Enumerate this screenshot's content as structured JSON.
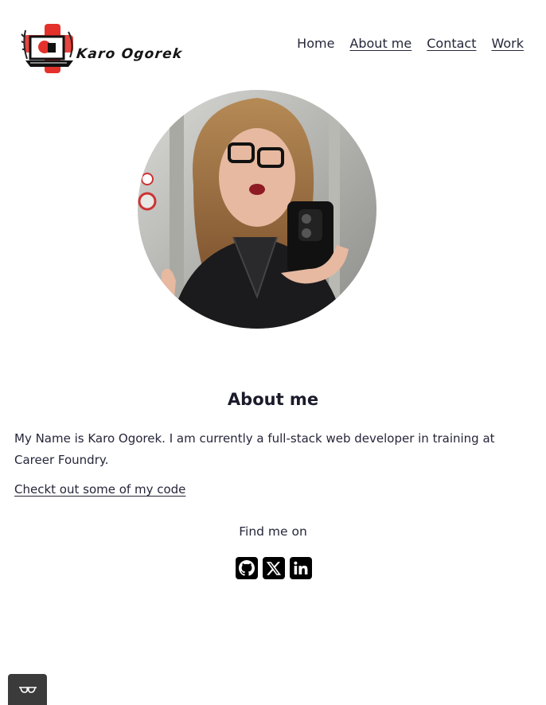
{
  "brand": {
    "name": "Karo Ogorek",
    "logo_icon": "laptop-logo-icon",
    "accent": "#e4312b"
  },
  "nav": {
    "items": [
      {
        "label": "Home",
        "underline": false
      },
      {
        "label": "About me",
        "underline": true
      },
      {
        "label": "Contact",
        "underline": true
      },
      {
        "label": "Work",
        "underline": true
      }
    ]
  },
  "profile": {
    "photo_icon": "profile-photo"
  },
  "about": {
    "title": "About me",
    "text": "My Name is Karo Ogorek. I am currently a full-stack web developer in training at Career Foundry.",
    "code_link": "Checkt out some of my code"
  },
  "social": {
    "heading": "Find me on",
    "icons": [
      "github-icon",
      "x-icon",
      "linkedin-icon"
    ]
  },
  "accessibility": {
    "icon": "glasses-icon"
  },
  "colors": {
    "text": "#26263a",
    "heading": "#1b1b2b",
    "background": "#ffffff"
  }
}
